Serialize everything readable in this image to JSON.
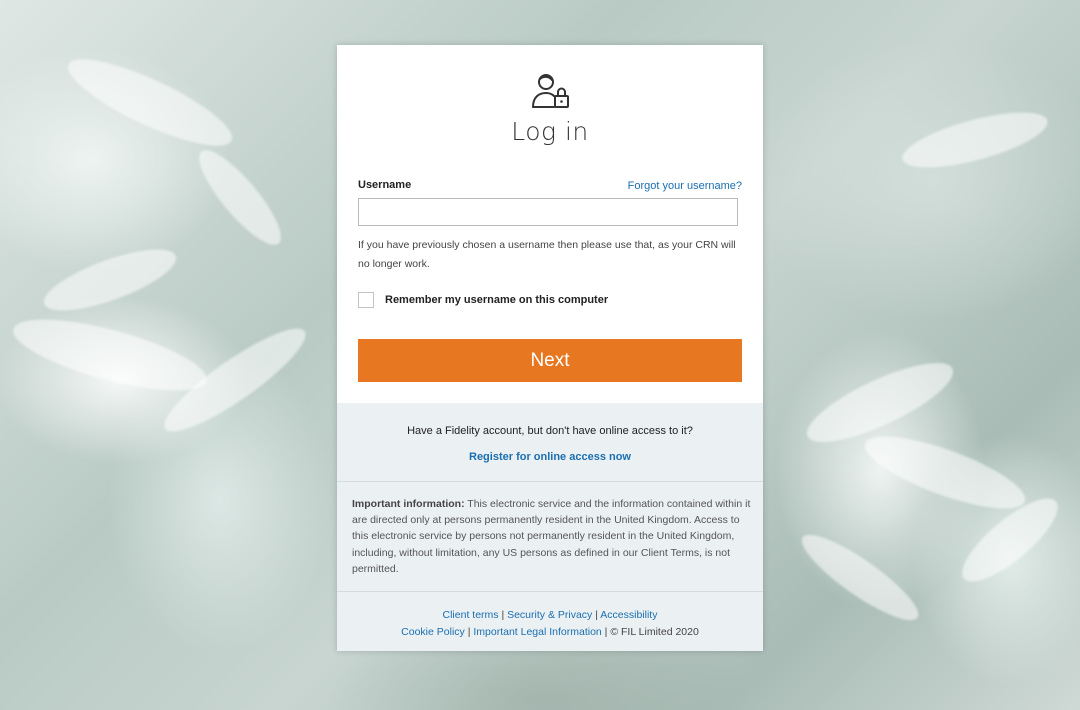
{
  "login": {
    "title": "Log in",
    "username_label": "Username",
    "forgot_link": "Forgot your username?",
    "username_value": "",
    "help_text": "If you have previously chosen a username then please use that, as your CRN will no longer work.",
    "remember_label": "Remember my username on this computer",
    "remember_checked": false,
    "next_button": "Next"
  },
  "access": {
    "question": "Have a Fidelity account, but don't have online access to it?",
    "register_link": "Register for online access now"
  },
  "important": {
    "heading": "Important information:",
    "body": " This electronic service and the information contained within it are directed only at persons permanently resident in the United Kingdom. Access to this electronic service by persons not permanently resident in the United Kingdom, including, without limitation, any US persons as defined in our Client Terms, is not permitted."
  },
  "footer": {
    "client_terms": "Client terms",
    "security_privacy": "Security & Privacy",
    "accessibility": "Accessibility",
    "cookie_policy": "Cookie Policy",
    "legal_info": "Important Legal Information",
    "copyright": "© FIL Limited 2020",
    "separator": " | "
  },
  "icons": {
    "user_lock": "user-lock-icon"
  },
  "colors": {
    "accent": "#e87722",
    "link": "#1b6fb0",
    "panel": "#ebf0f2"
  }
}
